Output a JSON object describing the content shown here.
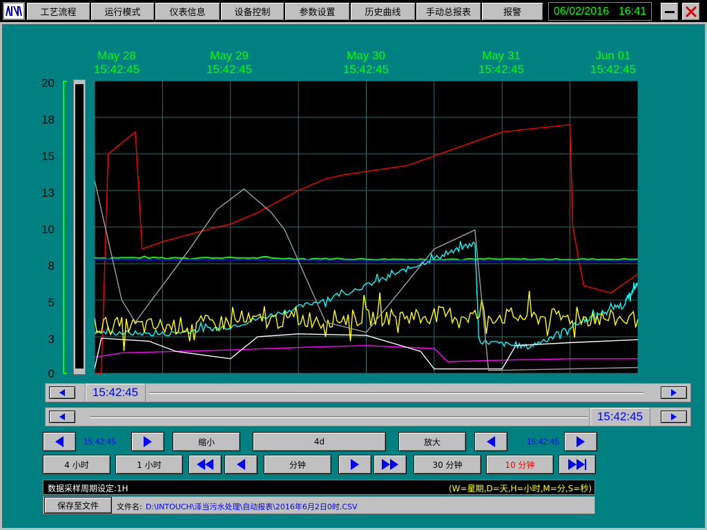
{
  "nav": {
    "items": [
      "工艺流程",
      "运行模式",
      "仪表信息",
      "设备控制",
      "参数设置",
      "历史曲线",
      "手动总报表",
      "报警"
    ]
  },
  "clock": {
    "date": "06/02/2016",
    "time": "16:41"
  },
  "trend": {
    "date_labels": [
      {
        "date": "May 28",
        "time": "15:42:45"
      },
      {
        "date": "May 29",
        "time": "15:42:45"
      },
      {
        "date": "May 30",
        "time": "15:42:45"
      },
      {
        "date": "May 31",
        "time": "15:42:45"
      },
      {
        "date": "Jun 01",
        "time": "15:42:45"
      }
    ],
    "y_ticks": [
      "20",
      "18",
      "15",
      "13",
      "10",
      "8",
      "5",
      "3",
      "0"
    ]
  },
  "scroll": {
    "start_time": "15:42:45",
    "end_time": "15:42:45"
  },
  "controls": {
    "left_time": "15:42:45",
    "zoom_out": "缩小",
    "span": "4d",
    "zoom_in": "放大",
    "right_time": "15:42:45",
    "btn_4h": "4 小时",
    "btn_1h": "1 小时",
    "minute": "分钟",
    "btn_30m": "30 分钟",
    "btn_10m": "10 分钟"
  },
  "status": {
    "period_label": "数据采样周期设定:1H",
    "legend": "(W=星期,D=天,H=小时,M=分,S=秒)",
    "save_button": "保存至文件",
    "file_label": "文件名:",
    "file_path": "D:\\INTOUCH\\泽当污水处理\\自动报表\\2016年6月2日0时.CSV"
  },
  "colors": {
    "panel": "#008080",
    "accent": "#00ff00",
    "control_text": "#0000ff"
  },
  "chart_data": {
    "type": "line",
    "x": [
      "May 28 15:42:45",
      "May 29 15:42:45",
      "May 30 15:42:45",
      "May 31 15:42:45",
      "Jun 01 15:42:45"
    ],
    "ylim": [
      0,
      20
    ],
    "grid": true,
    "series": [
      {
        "color": "#ff0000",
        "points": [
          [
            0,
            0
          ],
          [
            0.05,
            0
          ],
          [
            0.1,
            15
          ],
          [
            0.3,
            16.5
          ],
          [
            0.35,
            8.5
          ],
          [
            0.5,
            9
          ],
          [
            0.7,
            9.5
          ],
          [
            0.9,
            10
          ],
          [
            1.0,
            10.2
          ],
          [
            1.2,
            11
          ],
          [
            1.5,
            12.5
          ],
          [
            1.7,
            13.3
          ],
          [
            1.85,
            13.6
          ],
          [
            2.0,
            13.8
          ],
          [
            2.3,
            14.2
          ],
          [
            2.6,
            15.2
          ],
          [
            3.0,
            16.5
          ],
          [
            3.5,
            17
          ],
          [
            3.52,
            10
          ],
          [
            3.6,
            6
          ],
          [
            3.8,
            5.5
          ],
          [
            4.0,
            6.8
          ]
        ]
      },
      {
        "color": "#00ff00",
        "points": [
          [
            0,
            7.9
          ],
          [
            1,
            7.9
          ],
          [
            2,
            7.8
          ],
          [
            3,
            7.8
          ],
          [
            4,
            7.8
          ]
        ]
      },
      {
        "color": "#0000ff",
        "points": [
          [
            0,
            7.8
          ],
          [
            1,
            7.75
          ],
          [
            2,
            7.7
          ],
          [
            3,
            7.7
          ],
          [
            4,
            7.7
          ]
        ]
      },
      {
        "color": "#00ffff",
        "points": [
          [
            0,
            2.8
          ],
          [
            0.5,
            2.7
          ],
          [
            1,
            3.2
          ],
          [
            1.5,
            4.5
          ],
          [
            2,
            6
          ],
          [
            2.4,
            7.5
          ],
          [
            2.8,
            8.9
          ],
          [
            2.83,
            2.2
          ],
          [
            3.2,
            1.8
          ],
          [
            3.6,
            3.6
          ],
          [
            3.9,
            4.8
          ],
          [
            4.0,
            6.2
          ]
        ]
      },
      {
        "color": "#ffff00",
        "points": [
          [
            0,
            3.3
          ],
          [
            0.5,
            3.2
          ],
          [
            1,
            3.5
          ],
          [
            1.5,
            3.7
          ],
          [
            2,
            3.8
          ],
          [
            2.5,
            4.0
          ],
          [
            3,
            3.9
          ],
          [
            3.5,
            3.8
          ],
          [
            4,
            3.7
          ]
        ]
      },
      {
        "color": "#ff00ff",
        "points": [
          [
            0,
            1.1
          ],
          [
            0.2,
            1.4
          ],
          [
            0.6,
            1.5
          ],
          [
            1,
            1.6
          ],
          [
            1.6,
            1.8
          ],
          [
            2.0,
            1.9
          ],
          [
            2.5,
            1.7
          ],
          [
            2.6,
            0.8
          ],
          [
            3.0,
            0.9
          ],
          [
            3.5,
            1.0
          ],
          [
            4.0,
            1.0
          ]
        ]
      },
      {
        "color": "#ffffff",
        "points": [
          [
            0,
            0.3
          ],
          [
            0.05,
            2.4
          ],
          [
            0.4,
            2.2
          ],
          [
            0.6,
            1.5
          ],
          [
            1.0,
            1.0
          ],
          [
            1.2,
            2.5
          ],
          [
            1.5,
            2.7
          ],
          [
            2.0,
            2.6
          ],
          [
            2.4,
            1.5
          ],
          [
            2.5,
            0.3
          ],
          [
            3.0,
            0.3
          ],
          [
            3.1,
            1.9
          ],
          [
            3.5,
            2.1
          ],
          [
            4.0,
            2.3
          ]
        ]
      },
      {
        "color": "#a0a0a0",
        "points": [
          [
            0,
            13.2
          ],
          [
            0.2,
            5
          ],
          [
            0.3,
            3.5
          ],
          [
            0.7,
            8.5
          ],
          [
            0.9,
            11.2
          ],
          [
            1.1,
            12.6
          ],
          [
            1.3,
            11
          ],
          [
            1.4,
            9.8
          ],
          [
            1.7,
            3.5
          ],
          [
            2.0,
            2.8
          ],
          [
            2.5,
            8.5
          ],
          [
            2.8,
            9.8
          ],
          [
            2.9,
            0.2
          ],
          [
            3.5,
            0.3
          ],
          [
            4.0,
            0.4
          ]
        ]
      }
    ]
  }
}
